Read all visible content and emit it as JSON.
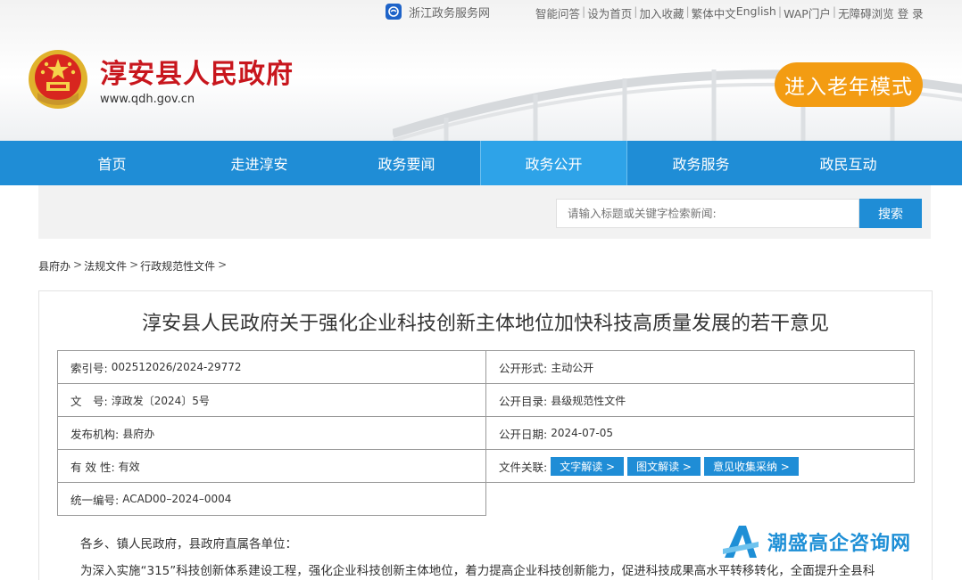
{
  "topbar": {
    "zj_link": "浙江政务服务网",
    "links": [
      "智能问答",
      "设为首页",
      "加入收藏",
      "繁体中文",
      "English",
      "WAP门户",
      "无障碍浏览",
      "登 录"
    ]
  },
  "header": {
    "site_title": "淳安县人民政府",
    "site_url": "www.qdh.gov.cn",
    "elder_mode": "进入老年模式"
  },
  "nav": {
    "items": [
      "首页",
      "走进淳安",
      "政务要闻",
      "政务公开",
      "政务服务",
      "政民互动"
    ],
    "active": "政务公开"
  },
  "search": {
    "placeholder": "请输入标题或关键字检索新闻:",
    "button": "搜索"
  },
  "breadcrumb": [
    "县府办",
    "法规文件",
    "行政规范性文件"
  ],
  "article": {
    "title": "淳安县人民政府关于强化企业科技创新主体地位加快科技高质量发展的若干意见",
    "meta": {
      "index_label": "索引号:",
      "index_value": "002512026/2024-29772",
      "form_label": "公开形式:",
      "form_value": "主动公开",
      "doc_label": "文　号:",
      "doc_value": "淳政发〔2024〕5号",
      "catalog_label": "公开目录:",
      "catalog_value": "县级规范性文件",
      "org_label": "发布机构:",
      "org_value": "县府办",
      "date_label": "公开日期:",
      "date_value": "2024-07-05",
      "valid_label": "有 效 性:",
      "valid_value": "有效",
      "related_label": "文件关联:",
      "related_buttons": [
        "文字解读 >",
        "图文解读 >",
        "意见收集采纳 >"
      ],
      "code_label": "统一编号:",
      "code_value": "ACAD00–2024–0004"
    },
    "salutation": "各乡、镇人民政府，县政府直属各单位：",
    "paragraph1": "为深入实施“315”科技创新体系建设工程，强化企业科技创新主体地位，着力提高企业科技创新能力，促进科技成果高水平转移转化，全面提升全县科"
  },
  "watermark": {
    "text": "潮盛高企咨询网"
  },
  "colors": {
    "nav_blue": "#1f8dd6",
    "title_red": "#c8161d",
    "elder_orange": "#f39c12"
  }
}
